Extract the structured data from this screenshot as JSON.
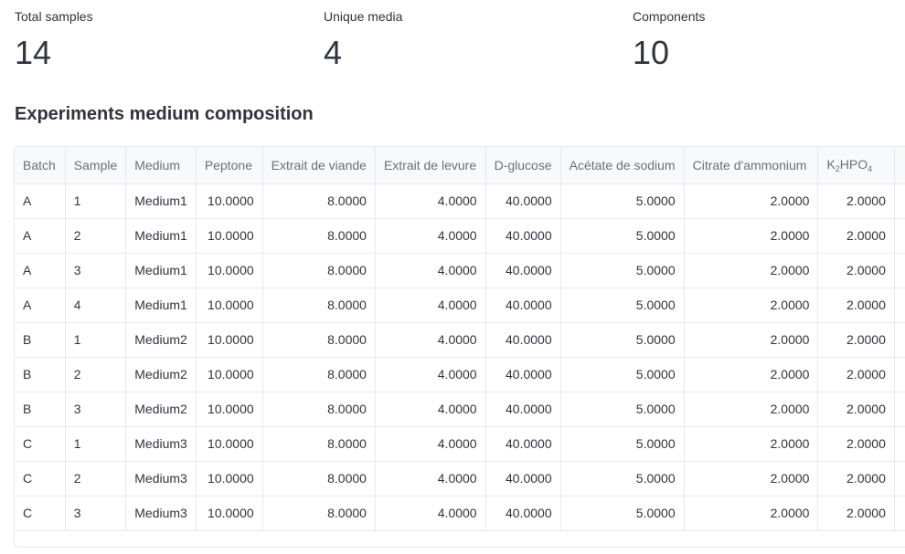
{
  "metrics": [
    {
      "label": "Total samples",
      "value": "14"
    },
    {
      "label": "Unique media",
      "value": "4"
    },
    {
      "label": "Components",
      "value": "10"
    }
  ],
  "section_title": "Experiments medium composition",
  "table": {
    "columns": [
      "Batch",
      "Sample",
      "Medium",
      "Peptone",
      "Extrait de viande",
      "Extrait de levure",
      "D-glucose",
      "Acétate de sodium",
      "Citrate d'ammonium"
    ],
    "k2hpo4": {
      "k": "K",
      "sub2": "2",
      "hpo": "HPO",
      "sub4": "4"
    },
    "rows": [
      [
        "A",
        "1",
        "Medium1",
        "10.0000",
        "8.0000",
        "4.0000",
        "40.0000",
        "5.0000",
        "2.0000",
        "2.0000"
      ],
      [
        "A",
        "2",
        "Medium1",
        "10.0000",
        "8.0000",
        "4.0000",
        "40.0000",
        "5.0000",
        "2.0000",
        "2.0000"
      ],
      [
        "A",
        "3",
        "Medium1",
        "10.0000",
        "8.0000",
        "4.0000",
        "40.0000",
        "5.0000",
        "2.0000",
        "2.0000"
      ],
      [
        "A",
        "4",
        "Medium1",
        "10.0000",
        "8.0000",
        "4.0000",
        "40.0000",
        "5.0000",
        "2.0000",
        "2.0000"
      ],
      [
        "B",
        "1",
        "Medium2",
        "10.0000",
        "8.0000",
        "4.0000",
        "40.0000",
        "5.0000",
        "2.0000",
        "2.0000"
      ],
      [
        "B",
        "2",
        "Medium2",
        "10.0000",
        "8.0000",
        "4.0000",
        "40.0000",
        "5.0000",
        "2.0000",
        "2.0000"
      ],
      [
        "B",
        "3",
        "Medium2",
        "10.0000",
        "8.0000",
        "4.0000",
        "40.0000",
        "5.0000",
        "2.0000",
        "2.0000"
      ],
      [
        "C",
        "1",
        "Medium3",
        "10.0000",
        "8.0000",
        "4.0000",
        "40.0000",
        "5.0000",
        "2.0000",
        "2.0000"
      ],
      [
        "C",
        "2",
        "Medium3",
        "10.0000",
        "8.0000",
        "4.0000",
        "40.0000",
        "5.0000",
        "2.0000",
        "2.0000"
      ],
      [
        "C",
        "3",
        "Medium3",
        "10.0000",
        "8.0000",
        "4.0000",
        "40.0000",
        "5.0000",
        "2.0000",
        "2.0000"
      ]
    ]
  }
}
